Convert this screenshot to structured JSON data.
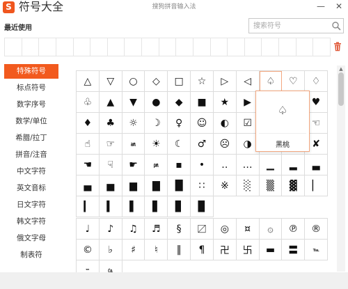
{
  "app": {
    "logo_letter": "S",
    "title": "符号大全",
    "window_caption": "搜狗拼音输入法"
  },
  "window_controls": {
    "minimize": "—",
    "close": "✕"
  },
  "recent": {
    "label": "最近使用"
  },
  "search": {
    "placeholder": "搜索符号"
  },
  "sidebar": {
    "items": [
      {
        "label": "特殊符号",
        "active": true
      },
      {
        "label": "标点符号"
      },
      {
        "label": "数字序号"
      },
      {
        "label": "数学/单位"
      },
      {
        "label": "希腊/拉丁"
      },
      {
        "label": "拼音/注音"
      },
      {
        "label": "中文字符"
      },
      {
        "label": "英文音标"
      },
      {
        "label": "日文字符"
      },
      {
        "label": "韩文字符"
      },
      {
        "label": "俄文字母"
      },
      {
        "label": "制表符"
      }
    ]
  },
  "grid1": {
    "rows": [
      [
        "△",
        "▽",
        "○",
        "◇",
        "□",
        "☆",
        "▷",
        "◁",
        "♤",
        "♡",
        "♢",
        "♧"
      ],
      [
        "▲",
        "▼",
        "●",
        "◆",
        "■",
        "★",
        "▶",
        "◀",
        "♠",
        "♥",
        "♦",
        "♣"
      ],
      [
        "☼",
        "☽",
        "♀",
        "☺",
        "◐",
        "☑",
        "√",
        "✔",
        "☜",
        "☝",
        "☞",
        "㏂"
      ],
      [
        "☀",
        "☾",
        "♂",
        "☹",
        "◑",
        "☒",
        "×",
        "✘",
        "☚",
        "☟",
        "☛",
        "㏘"
      ],
      [
        "▪",
        "•",
        "‥",
        "…",
        "▁",
        "▂",
        "▃",
        "▄",
        "▅",
        "▆",
        "▇",
        "█"
      ],
      [
        "∷",
        "※",
        "░",
        "▒",
        "▓",
        "▏",
        "▎",
        "▍",
        "▌",
        "▋",
        "▊",
        "▉"
      ]
    ]
  },
  "grid2": {
    "rows": [
      [
        "♩",
        "♪",
        "♫",
        "♬",
        "§",
        "〼",
        "◎",
        "¤",
        "۞",
        "℗",
        "®",
        "©"
      ],
      [
        "♭",
        "♯",
        "♮",
        "‖",
        "¶",
        "卍",
        "卐",
        "▬",
        "〓",
        "℡",
        "™",
        "㏇"
      ]
    ]
  },
  "popup": {
    "symbol": "♤",
    "name": "黑桃"
  },
  "colors": {
    "accent": "#f25a1e",
    "highlight_border": "#f3a77f",
    "grid_line": "#dcdcdc"
  }
}
